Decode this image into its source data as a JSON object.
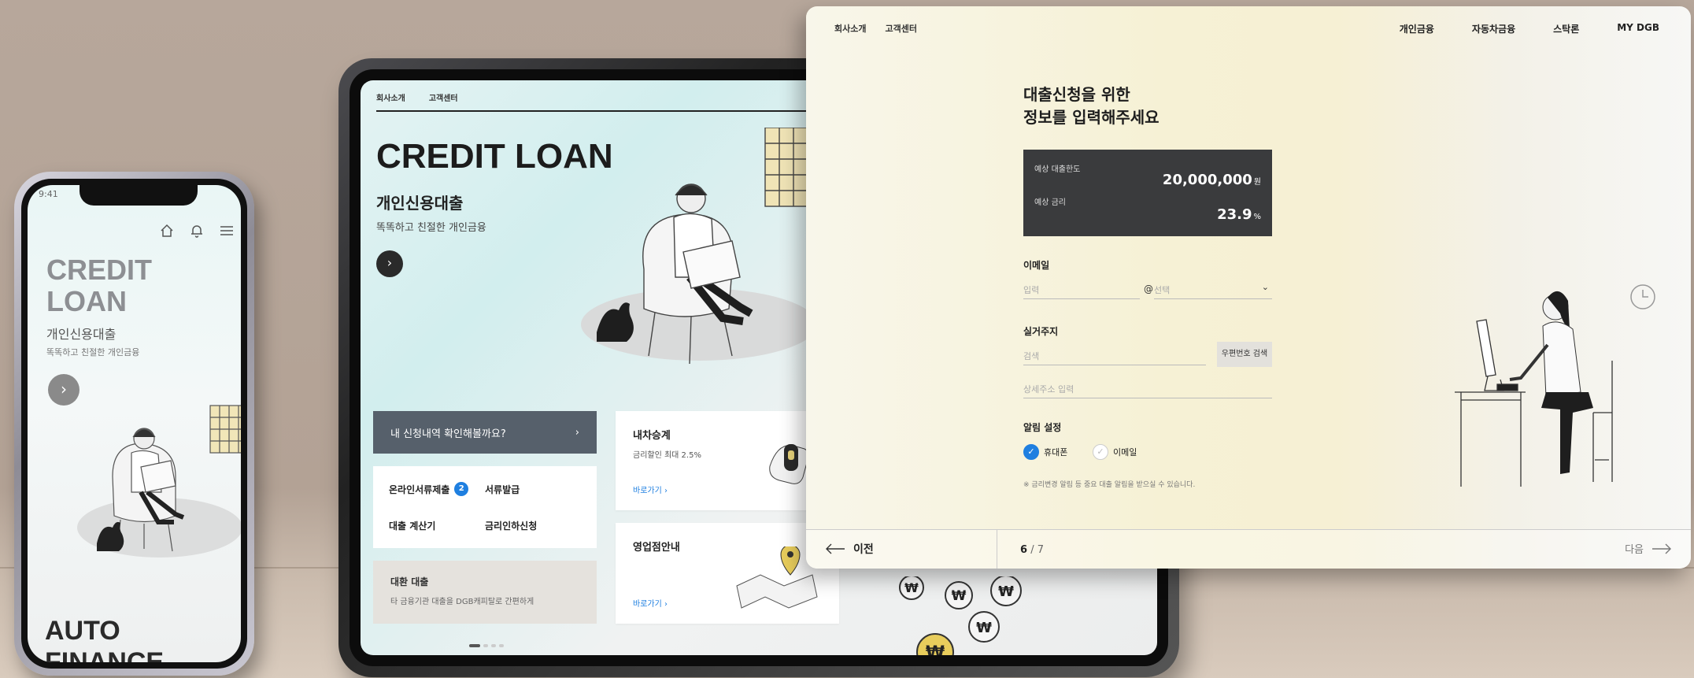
{
  "phone": {
    "time": "9:41",
    "title_line1": "CREDIT",
    "title_line2": "LOAN",
    "subtitle": "개인신용대출",
    "tagline": "똑똑하고 친절한 개인금융",
    "next_arrow": "›",
    "auto_line1": "AUTO",
    "auto_line2": "FINANCE",
    "nav_icons": [
      "home-icon",
      "bell-icon",
      "menu-icon"
    ]
  },
  "tablet": {
    "nav": [
      "회사소개",
      "고객센터"
    ],
    "title": "CREDIT LOAN",
    "subtitle": "개인신용대출",
    "tagline": "똑똑하고 친절한 개인금융",
    "next_arrow": "›",
    "apply_check": "내 신청내역 확인해볼까요?",
    "apply_check_arrow": "›",
    "menu": {
      "online_docs": "온라인서류제출",
      "online_docs_badge": "2",
      "doc_issue": "서류발급",
      "loan_calc": "대출 계산기",
      "rate_cut": "금리인하신청"
    },
    "refinance": {
      "title": "대환 대출",
      "desc": "타 금융기관 대출을 DGB캐피탈로 간편하게"
    },
    "car_transfer": {
      "title": "내차승계",
      "desc": "금리할인 최대 2.5%",
      "link": "바로가기 ›"
    },
    "branch": {
      "title": "영업점안내",
      "link": "바로가기 ›"
    },
    "coin_symbol": "₩"
  },
  "desktop": {
    "nav_left": [
      "회사소개",
      "고객센터"
    ],
    "nav_right": [
      "개인금융",
      "자동차금융",
      "스탁론",
      "MY DGB"
    ],
    "heading_line1": "대출신청을 위한",
    "heading_line2": "정보를 입력해주세요",
    "summary": {
      "limit_label": "예상 대출한도",
      "limit_value": "20,000,000",
      "limit_unit": "원",
      "rate_label": "예상 금리",
      "rate_value": "23.9",
      "rate_unit": "%"
    },
    "email_label": "이메일",
    "email_placeholder": "입력",
    "email_at": "@",
    "email_domain_placeholder": "선택",
    "address_label": "실거주지",
    "address_placeholder": "검색",
    "zip_button": "우편번호 검색",
    "address_detail_placeholder": "상세주소 입력",
    "notify_label": "알림 설정",
    "notify_options": [
      {
        "label": "휴대폰",
        "checked": true
      },
      {
        "label": "이메일",
        "checked": false
      }
    ],
    "notice": "※ 금리변경 알림 등 중요 대출 알림을 받으실 수 있습니다.",
    "prev_label": "이전",
    "page_current": "6",
    "page_total": "/ 7",
    "next_label": "다음",
    "accent_color": "#1f7fe0",
    "summary_bg": "#3a3b3d"
  }
}
